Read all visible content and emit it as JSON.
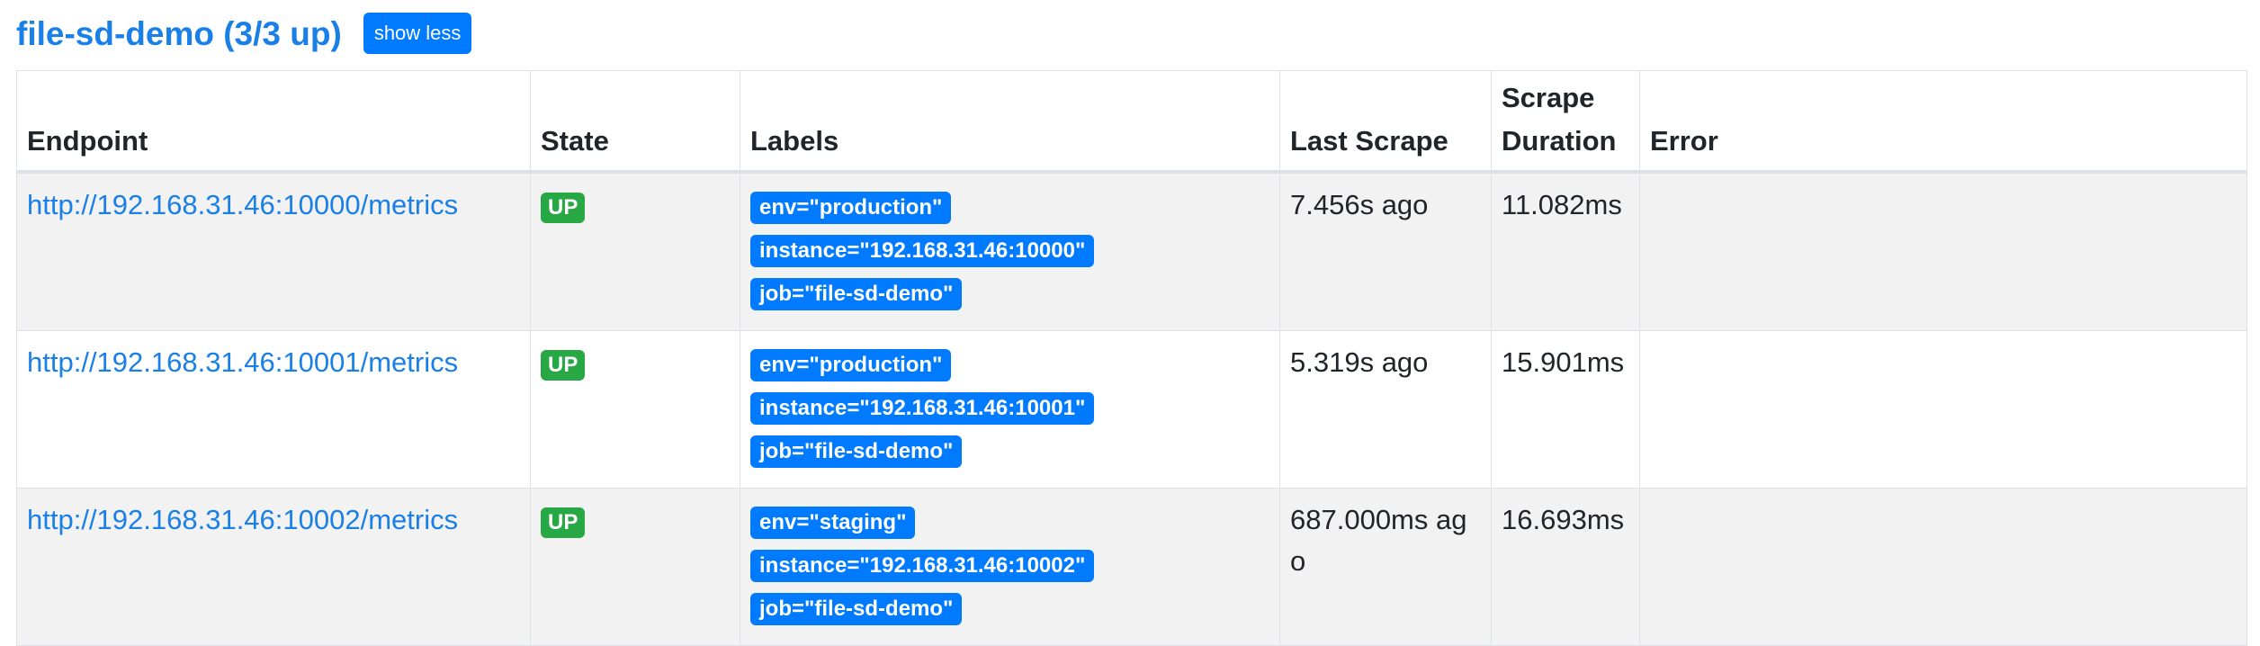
{
  "job": {
    "title": "file-sd-demo (3/3 up)",
    "toggle_label": "show less"
  },
  "table": {
    "headers": {
      "endpoint": "Endpoint",
      "state": "State",
      "labels": "Labels",
      "last_scrape": "Last Scrape",
      "scrape_duration_line1": "Scrape",
      "scrape_duration_line2": "Duration",
      "error": "Error"
    },
    "rows": [
      {
        "endpoint": "http://192.168.31.46:10000/metrics",
        "state": "UP",
        "labels": [
          "env=\"production\"",
          "instance=\"192.168.31.46:10000\"",
          "job=\"file-sd-demo\""
        ],
        "last_scrape": "7.456s ago",
        "scrape_duration": "11.082ms",
        "error": ""
      },
      {
        "endpoint": "http://192.168.31.46:10001/metrics",
        "state": "UP",
        "labels": [
          "env=\"production\"",
          "instance=\"192.168.31.46:10001\"",
          "job=\"file-sd-demo\""
        ],
        "last_scrape": "5.319s ago",
        "scrape_duration": "15.901ms",
        "error": ""
      },
      {
        "endpoint": "http://192.168.31.46:10002/metrics",
        "state": "UP",
        "labels": [
          "env=\"staging\"",
          "instance=\"192.168.31.46:10002\"",
          "job=\"file-sd-demo\""
        ],
        "last_scrape": "687.000ms ago",
        "scrape_duration": "16.693ms",
        "error": ""
      }
    ]
  },
  "colors": {
    "link": "#1a7fe6",
    "primary": "#007bff",
    "success": "#28a745",
    "row_striped": "#f2f2f2"
  }
}
